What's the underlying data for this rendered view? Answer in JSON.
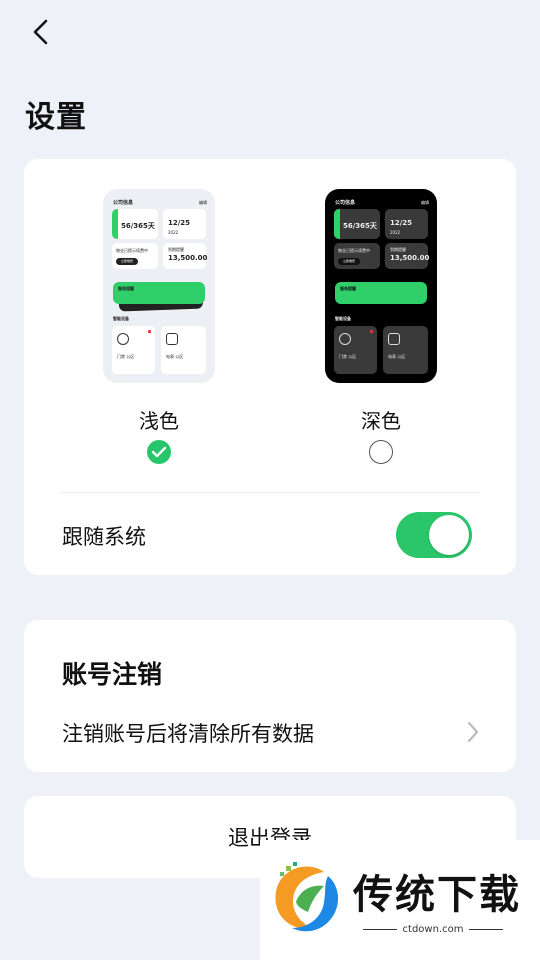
{
  "header": {
    "title": "设置"
  },
  "theme": {
    "options": [
      {
        "label": "浅色",
        "selected": true
      },
      {
        "label": "深色",
        "selected": false
      }
    ],
    "follow_system": {
      "label": "跟随系统",
      "enabled": true
    },
    "colors": {
      "accent": "#2bc66a"
    }
  },
  "preview": {
    "heading": "公司信息",
    "heading_right": "编辑",
    "days": "56/365天",
    "date": "12/25",
    "year": "2022",
    "amount": "13,500.00",
    "due_label": "到期提醒",
    "hint": "物业已提示续费中",
    "pill": "立即缴费",
    "notice_title": "服务提醒",
    "section": "智能设备",
    "device1": "门禁 公区",
    "device2": "电表 公区"
  },
  "account": {
    "title": "账号注销",
    "description": "注销账号后将清除所有数据"
  },
  "logout": {
    "label": "退出登录"
  },
  "watermark": {
    "text": "传统下载",
    "url": "ctdown.com"
  }
}
